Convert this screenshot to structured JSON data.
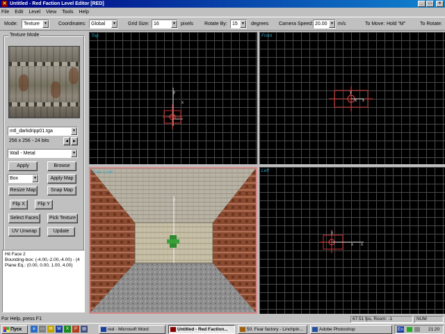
{
  "window": {
    "title": "Untitled - Red Faction Level Editor [RED]",
    "app_icon": "red-faction-icon",
    "controls": {
      "minimize": "_",
      "maximize": "□",
      "close": "×"
    }
  },
  "menu": [
    "File",
    "Edit",
    "Level",
    "View",
    "Tools",
    "Help"
  ],
  "toolbar": {
    "mode_label": "Mode:",
    "mode_value": "Texture",
    "coords_label": "Coordinates:",
    "coords_value": "Global",
    "grid_label": "Grid Size:",
    "grid_value": "16",
    "grid_unit": "pixels",
    "rotate_label": "Rotate By:",
    "rotate_value": "15",
    "rotate_unit": "degrees",
    "camspeed_label": "Camera Speed:",
    "camspeed_value": "20.00",
    "camspeed_unit": "m/s",
    "tomove_label": "To Move:",
    "tomove_value": "Hold \"M\"",
    "torotate_label": "To Rotate:"
  },
  "texture_panel": {
    "group_label": "Texture Mode",
    "texture_name": "mtl_darkdripp01.tga",
    "texture_info": "256 x 256 - 24 bits",
    "material": "Wall - Metal",
    "shape": "Box",
    "buttons": {
      "apply": "Apply",
      "browse": "Browse",
      "apply_map": "Apply Map",
      "resize_map": "Resize Map",
      "snap_map": "Snap Map",
      "flip_x": "Flip X",
      "flip_y": "Flip Y",
      "select_faces": "Select Faces",
      "pick_texture": "Pick Texture",
      "uv_unwrap": "UV Unwrap",
      "update": "Update"
    },
    "info": {
      "line1": "Hit Face 2",
      "line2": "Bounding-box: (-4.00,-2.00,-4.00) - (4",
      "line3": "Plane Eq.: (0.00, 0.00, 1.00, 4.00)"
    }
  },
  "viewports": {
    "top": "Top",
    "front": "Front",
    "free_look": "Free Look",
    "left": "Left"
  },
  "statusbar": {
    "help": "For Help, press F1",
    "fps": "67.51 fps, Room: -1",
    "num": "NUM"
  },
  "taskbar": {
    "start": "Пуск",
    "tasks": [
      {
        "label": "red - Microsoft Word",
        "icon": "word-icon"
      },
      {
        "label": "Untitled - Red Faction...",
        "icon": "red-faction-icon"
      },
      {
        "label": "50. Fear factory - Linchpin...",
        "icon": "winamp-icon"
      },
      {
        "label": "Adobe Photoshop",
        "icon": "photoshop-icon"
      }
    ],
    "lang": "En",
    "clock": "21:20"
  },
  "colors": {
    "titlebar": "#000080",
    "viewport_bg": "#000000",
    "grid": "#4a4a4a",
    "selection": "#d66666",
    "viewport_label": "#2aa8c8"
  }
}
